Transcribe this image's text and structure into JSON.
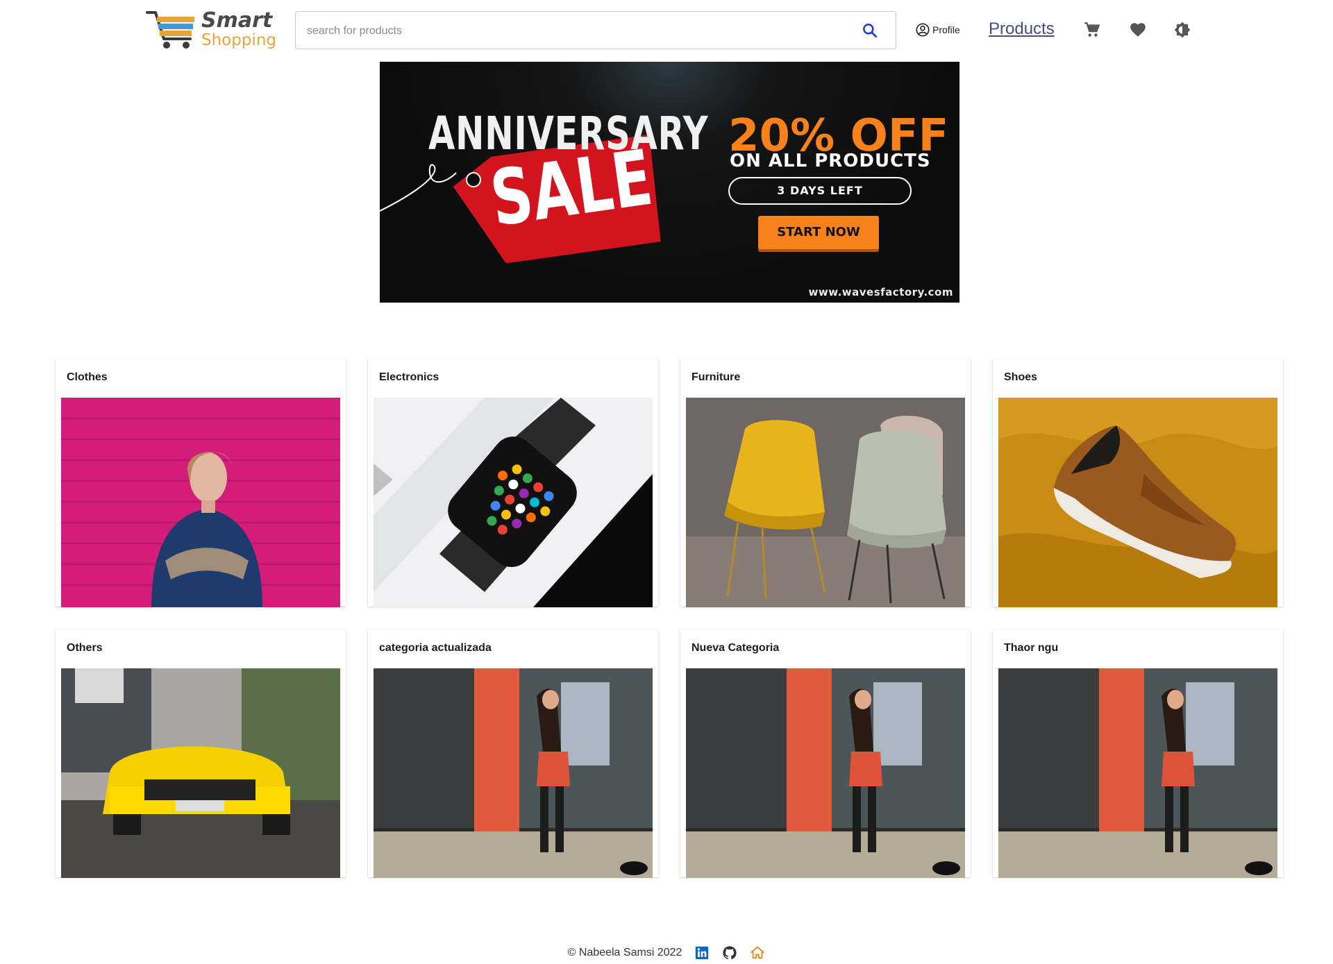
{
  "header": {
    "logo": {
      "line1": "Smart",
      "line2": "Shopping"
    },
    "search": {
      "placeholder": "search for products",
      "value": ""
    },
    "nav": {
      "profile_label": "Profile",
      "products_label": "Products"
    },
    "icons": [
      "search-icon",
      "account-circle-icon",
      "cart-icon",
      "heart-icon",
      "brightness-icon"
    ]
  },
  "banner": {
    "headline": "ANNIVERSARY",
    "tag": "SALE",
    "offer": "20% OFF",
    "offer_sub": "ON ALL PRODUCTS",
    "days_left": "3 DAYS LEFT",
    "cta": "START NOW",
    "url": "www.wavesfactory.com",
    "accent": "#f7821b",
    "tag_color": "#d3141e"
  },
  "categories": [
    {
      "name": "Clothes"
    },
    {
      "name": "Electronics"
    },
    {
      "name": "Furniture"
    },
    {
      "name": "Shoes"
    },
    {
      "name": "Others"
    },
    {
      "name": "categoria actualizada"
    },
    {
      "name": "Nueva Categoria"
    },
    {
      "name": "Thaor ngu"
    }
  ],
  "footer": {
    "copyright": "© Nabeela Samsi 2022",
    "icons": [
      "linkedin-icon",
      "github-icon",
      "home-icon"
    ],
    "linkedin_color": "#0a66c2",
    "home_color": "#f7821b"
  }
}
